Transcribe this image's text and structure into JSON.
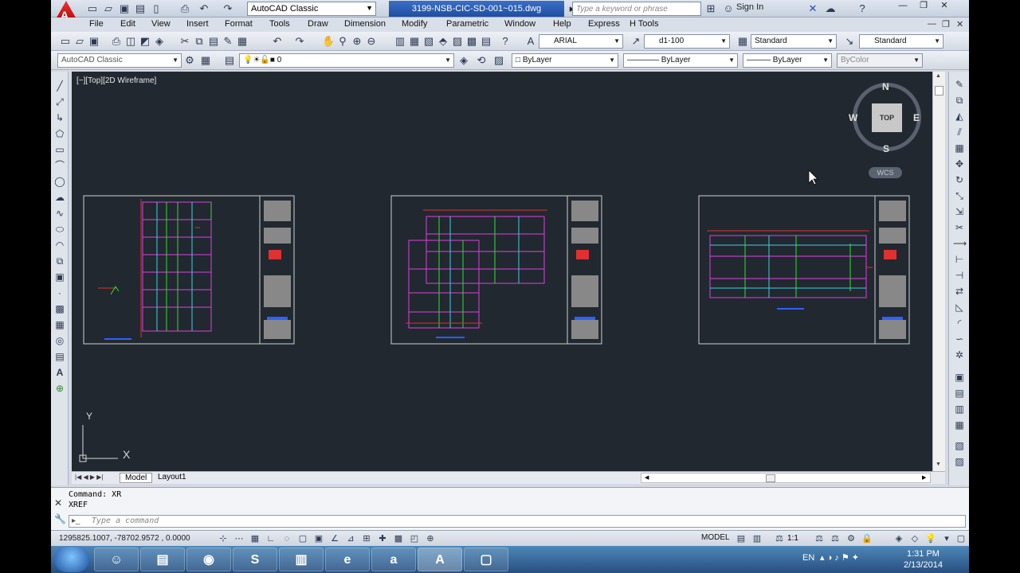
{
  "window": {
    "app_button_letter": "A",
    "workspace": "AutoCAD Classic",
    "file_tab": "3199-NSB-CIC-SD-001~015.dwg",
    "search_placeholder": "Type a keyword or phrase",
    "sign_in": "Sign In"
  },
  "menu": [
    "File",
    "Edit",
    "View",
    "Insert",
    "Format",
    "Tools",
    "Draw",
    "Dimension",
    "Modify",
    "Parametric",
    "Window",
    "Help",
    "Express",
    "H Tools"
  ],
  "toolbar1": {
    "text_style_font": "ARIAL",
    "dim_style": "d1-100",
    "table_style": "Standard",
    "multileader_style": "Standard"
  },
  "toolbar2": {
    "workspace": "AutoCAD Classic",
    "layer": "0",
    "color": "ByLayer",
    "linetype": "ByLayer",
    "lineweight": "ByLayer",
    "plotstyle": "ByColor"
  },
  "viewport": {
    "label": "[−][Top][2D Wireframe]",
    "viewcube": {
      "n": "N",
      "s": "S",
      "e": "E",
      "w": "W",
      "face": "TOP",
      "wcs": "WCS"
    },
    "ucs_x": "X",
    "ucs_y": "Y"
  },
  "layout_tabs": [
    "Model",
    "Layout1"
  ],
  "command": {
    "history": [
      "Command: XR",
      "XREF"
    ],
    "placeholder": "Type a command"
  },
  "status": {
    "coords": "1295825.1007, -78702.9572 , 0.0000",
    "model": "MODEL",
    "scale": "1:1"
  },
  "taskbar": {
    "language": "EN",
    "time": "1:31 PM",
    "date": "2/13/2014"
  },
  "colors": {
    "viewport_bg": "#212830",
    "drawing_magenta": "#e040e0",
    "drawing_green": "#30e030",
    "drawing_cyan": "#40d0e0",
    "drawing_red": "#e03030",
    "drawing_blue": "#3060ff"
  }
}
